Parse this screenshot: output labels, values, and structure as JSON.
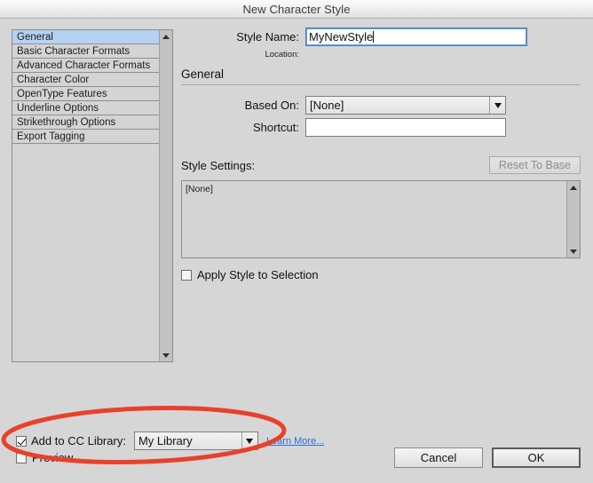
{
  "window": {
    "title": "New Character Style"
  },
  "sidebar": {
    "items": [
      {
        "label": "General",
        "selected": true
      },
      {
        "label": "Basic Character Formats",
        "selected": false
      },
      {
        "label": "Advanced Character Formats",
        "selected": false
      },
      {
        "label": "Character Color",
        "selected": false
      },
      {
        "label": "OpenType Features",
        "selected": false
      },
      {
        "label": "Underline Options",
        "selected": false
      },
      {
        "label": "Strikethrough Options",
        "selected": false
      },
      {
        "label": "Export Tagging",
        "selected": false
      }
    ],
    "scroll_up_icon": "triangle-up-icon",
    "scroll_down_icon": "triangle-down-icon"
  },
  "main": {
    "style_name_label": "Style Name:",
    "style_name_value": "MyNewStyle",
    "location_label": "Location:",
    "location_value": "",
    "section_title": "General",
    "based_on_label": "Based On:",
    "based_on_value": "[None]",
    "shortcut_label": "Shortcut:",
    "shortcut_value": "",
    "style_settings_label": "Style Settings:",
    "reset_to_base_label": "Reset To Base",
    "reset_to_base_disabled": true,
    "style_settings_value": "[None]",
    "apply_style_label": "Apply Style to Selection",
    "apply_style_checked": false
  },
  "footer": {
    "add_to_cc_library_label": "Add to CC Library:",
    "add_to_cc_library_checked": true,
    "cc_library_value": "My Library",
    "learn_more_label": "Learn More...",
    "preview_label": "Preview",
    "preview_checked": false,
    "cancel_label": "Cancel",
    "ok_label": "OK"
  },
  "annotation": {
    "shape": "ellipse",
    "color": "#e8412b",
    "stroke_width": 5
  },
  "colors": {
    "dialog_bg": "#d6d6d6",
    "selection_blue": "#b5d2f2",
    "link_blue": "#2a6fd6",
    "annotation_red": "#e8412b"
  }
}
